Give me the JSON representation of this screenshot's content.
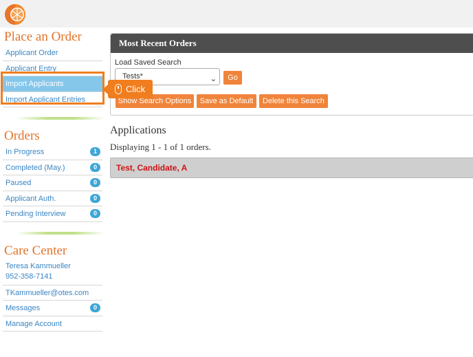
{
  "brand": {
    "logo_icon": "orange-slice-logo-icon",
    "accent": "#e2742a"
  },
  "sidebar": {
    "place_order": {
      "title": "Place an Order",
      "items": [
        {
          "label": "Applicant Order"
        },
        {
          "label": "Applicant Entry"
        },
        {
          "label": "Import Applicants",
          "active": true
        },
        {
          "label": "Import Applicant Entries"
        }
      ]
    },
    "orders": {
      "title": "Orders",
      "items": [
        {
          "label": "In Progress",
          "count": "1"
        },
        {
          "label": "Completed (May.)",
          "count": "0"
        },
        {
          "label": "Paused",
          "count": "0"
        },
        {
          "label": "Applicant Auth.",
          "count": "0"
        },
        {
          "label": "Pending Interview",
          "count": "0"
        }
      ]
    },
    "care_center": {
      "title": "Care Center",
      "contact_name": "Teresa Kammueller",
      "contact_phone": "952-358-7141",
      "contact_email": "TKammueller@otes.com",
      "messages_label": "Messages",
      "messages_count": "0",
      "manage_account_label": "Manage Account"
    }
  },
  "callout": {
    "label": "Click",
    "icon": "mouse-icon"
  },
  "recent_orders": {
    "title": "Most Recent Orders",
    "load_saved_label": "Load Saved Search",
    "saved_search_value": "Tests*",
    "go_label": "Go",
    "show_options_label": "Show Search Options",
    "save_default_label": "Save as Default",
    "delete_search_label": "Delete this Search"
  },
  "applications": {
    "title": "Applications",
    "count_text": "Displaying 1 - 1 of 1 orders.",
    "rows": [
      {
        "name": "Test, Candidate, A"
      }
    ]
  }
}
